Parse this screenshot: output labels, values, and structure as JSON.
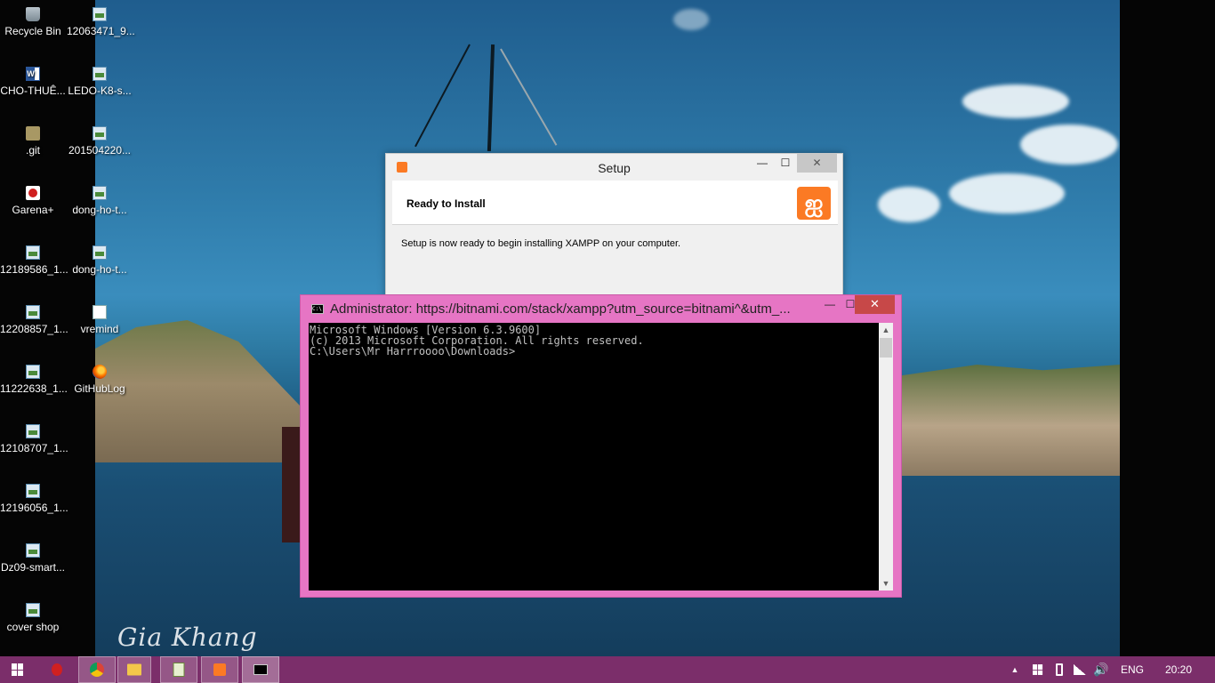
{
  "desktop": {
    "col1": [
      {
        "label": "Recycle Bin",
        "icon": "recycle-bin-icon"
      },
      {
        "label": "CHO-THUÊ...",
        "icon": "word-document-icon"
      },
      {
        "label": ".git",
        "icon": "folder-icon"
      },
      {
        "label": "Garena+",
        "icon": "garena-icon"
      },
      {
        "label": "12189586_1...",
        "icon": "image-file-icon"
      },
      {
        "label": "12208857_1...",
        "icon": "image-file-icon"
      },
      {
        "label": "11222638_1...",
        "icon": "image-file-icon"
      },
      {
        "label": "12108707_1...",
        "icon": "image-file-icon"
      },
      {
        "label": "12196056_1...",
        "icon": "image-file-icon"
      },
      {
        "label": "Dz09-smart...",
        "icon": "image-file-icon"
      },
      {
        "label": "cover shop",
        "icon": "image-file-icon"
      }
    ],
    "col2": [
      {
        "label": "12063471_9...",
        "icon": "image-file-icon"
      },
      {
        "label": "LEDO-K8-s...",
        "icon": "image-file-icon"
      },
      {
        "label": "201504220...",
        "icon": "image-file-icon"
      },
      {
        "label": "dong-ho-t...",
        "icon": "image-file-icon"
      },
      {
        "label": "dong-ho-t...",
        "icon": "image-file-icon"
      },
      {
        "label": "vremind",
        "icon": "text-document-icon"
      },
      {
        "label": "GitHubLog",
        "icon": "firefox-icon"
      }
    ],
    "watermark": "Gia Khang"
  },
  "setup_window": {
    "title": "Setup",
    "header_title": "Ready to Install",
    "body_text": "Setup is now ready to begin installing XAMPP on your computer.",
    "minimize": "—",
    "maximize": "☐",
    "close": "✕",
    "logo_glyph": "ஐ"
  },
  "cmd_window": {
    "title": "Administrator: https://bitnami.com/stack/xampp?utm_source=bitnami^&utm_...",
    "lines": [
      "Microsoft Windows [Version 6.3.9600]",
      "(c) 2013 Microsoft Corporation. All rights reserved.",
      "",
      "C:\\Users\\Mr Harrroooo\\Downloads>"
    ],
    "minimize": "—",
    "maximize": "☐",
    "close": "✕",
    "icon_text": "C:\\"
  },
  "taskbar": {
    "language": "ENG",
    "time": "20:20",
    "accent": "#7b2e6a"
  }
}
